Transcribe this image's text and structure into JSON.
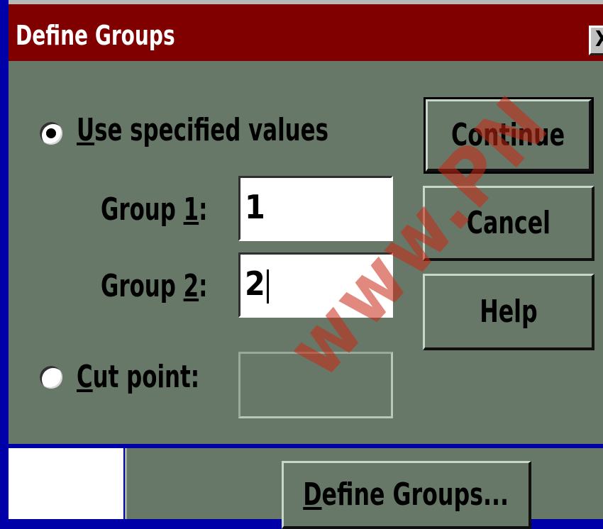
{
  "dialog": {
    "title": "Define Groups",
    "close_label": "X"
  },
  "options": {
    "use_specified": {
      "prefix": "U",
      "rest": "se specified values",
      "selected": true
    },
    "cut_point": {
      "prefix": "C",
      "rest": "ut point:",
      "selected": false
    }
  },
  "group1": {
    "label_pre": "Group ",
    "label_key": "1",
    "label_post": ":",
    "value": "1"
  },
  "group2": {
    "label_pre": "Group ",
    "label_key": "2",
    "label_post": ":",
    "value": "2"
  },
  "cut_point_value": "",
  "buttons": {
    "continue": "Continue",
    "cancel": "Cancel",
    "help": "Help"
  },
  "bottom": {
    "define_groups_prefix": "D",
    "define_groups_rest": "efine Groups..."
  },
  "watermark": "www.PN",
  "colors": {
    "title_bar": "#800000",
    "dialog_bg": "#687868",
    "desktop": "#0000a8"
  }
}
